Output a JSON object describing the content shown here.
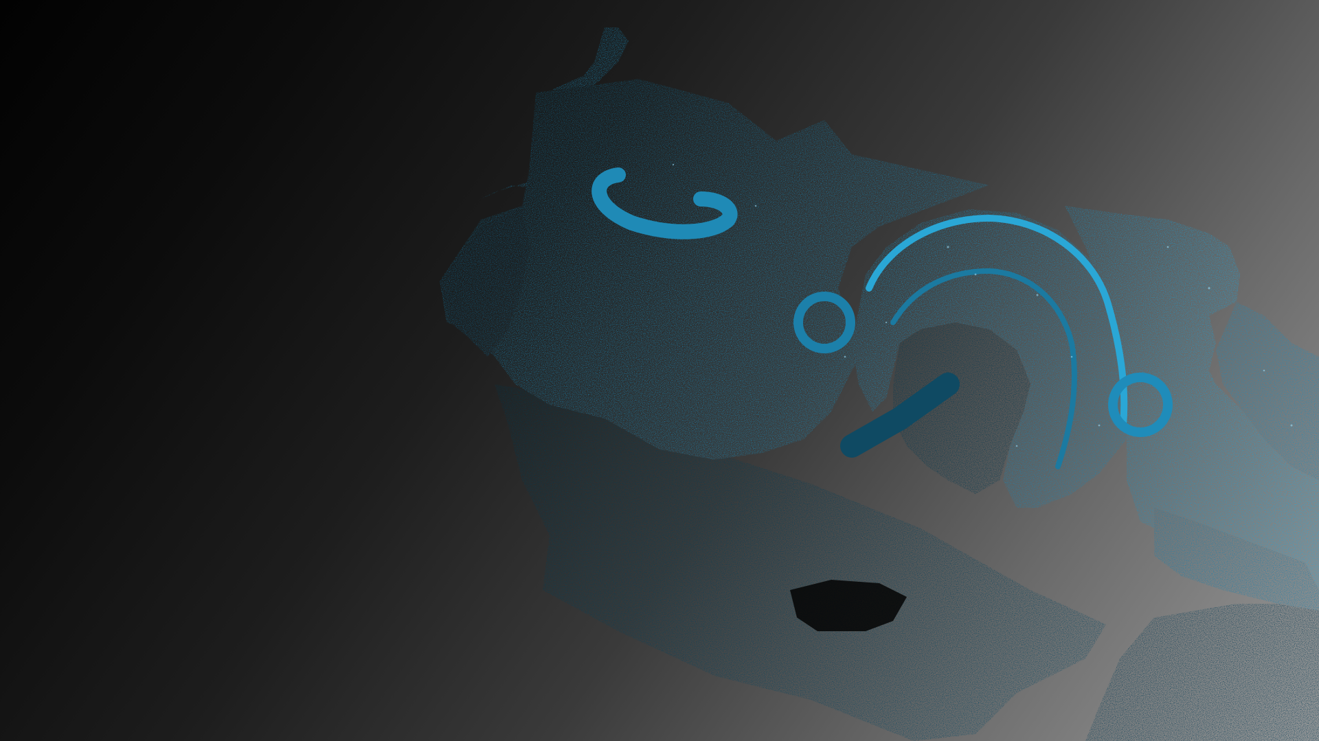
{
  "viewer": {
    "background_dark": "#030303",
    "background_light": "#9a9a9a"
  },
  "scan": {
    "subject": "point-cloud-scan",
    "colors": {
      "highlight": "#2aa7d6",
      "primary": "#1e86b0",
      "mid": "#176c8f",
      "dark": "#0f4a63",
      "deep": "#0a3446",
      "speckle_light": "#9fe3ff",
      "speckle_dark": "#06141b"
    }
  }
}
